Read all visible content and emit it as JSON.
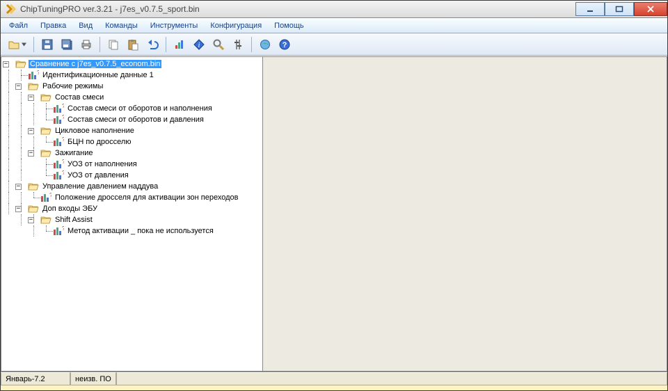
{
  "titlebar": {
    "title": "ChipTuningPRO ver.3.21 - j7es_v0.7.5_sport.bin"
  },
  "menu": {
    "file": "Файл",
    "edit": "Правка",
    "view": "Вид",
    "commands": "Команды",
    "tools": "Инструменты",
    "config": "Конфигурация",
    "help": "Помощь"
  },
  "toolbar": {
    "open": "open",
    "save": "save",
    "saveall": "save-all",
    "print": "print",
    "copy": "copy",
    "paste": "paste",
    "undo": "undo",
    "chart": "chart",
    "info": "info",
    "find": "find",
    "settings": "settings",
    "globe": "globe",
    "about": "about"
  },
  "tree": {
    "root": "Сравнение с j7es_v0.7.5_econom.bin",
    "ident": "Идентификационные данные 1",
    "modes": "Рабочие режимы",
    "mix": "Состав смеси",
    "mix_rev_fill": "Состав смеси от оборотов и наполнения",
    "mix_rev_press": "Состав смеси от оборотов и давления",
    "cycle": "Цикловое наполнение",
    "bcn": "БЦН по дросселю",
    "ignition": "Зажигание",
    "uoz_fill": "УОЗ от наполнения",
    "uoz_press": "УОЗ от давления",
    "boost": "Управление давлением наддува",
    "throttle_zones": "Положение дросселя для активации зон переходов",
    "aux": "Доп входы ЭБУ",
    "shift": "Shift Assist",
    "activation": "Метод активации _ пока не используется"
  },
  "status": {
    "cell1": "Январь-7.2",
    "cell2": "неизв. ПО"
  }
}
